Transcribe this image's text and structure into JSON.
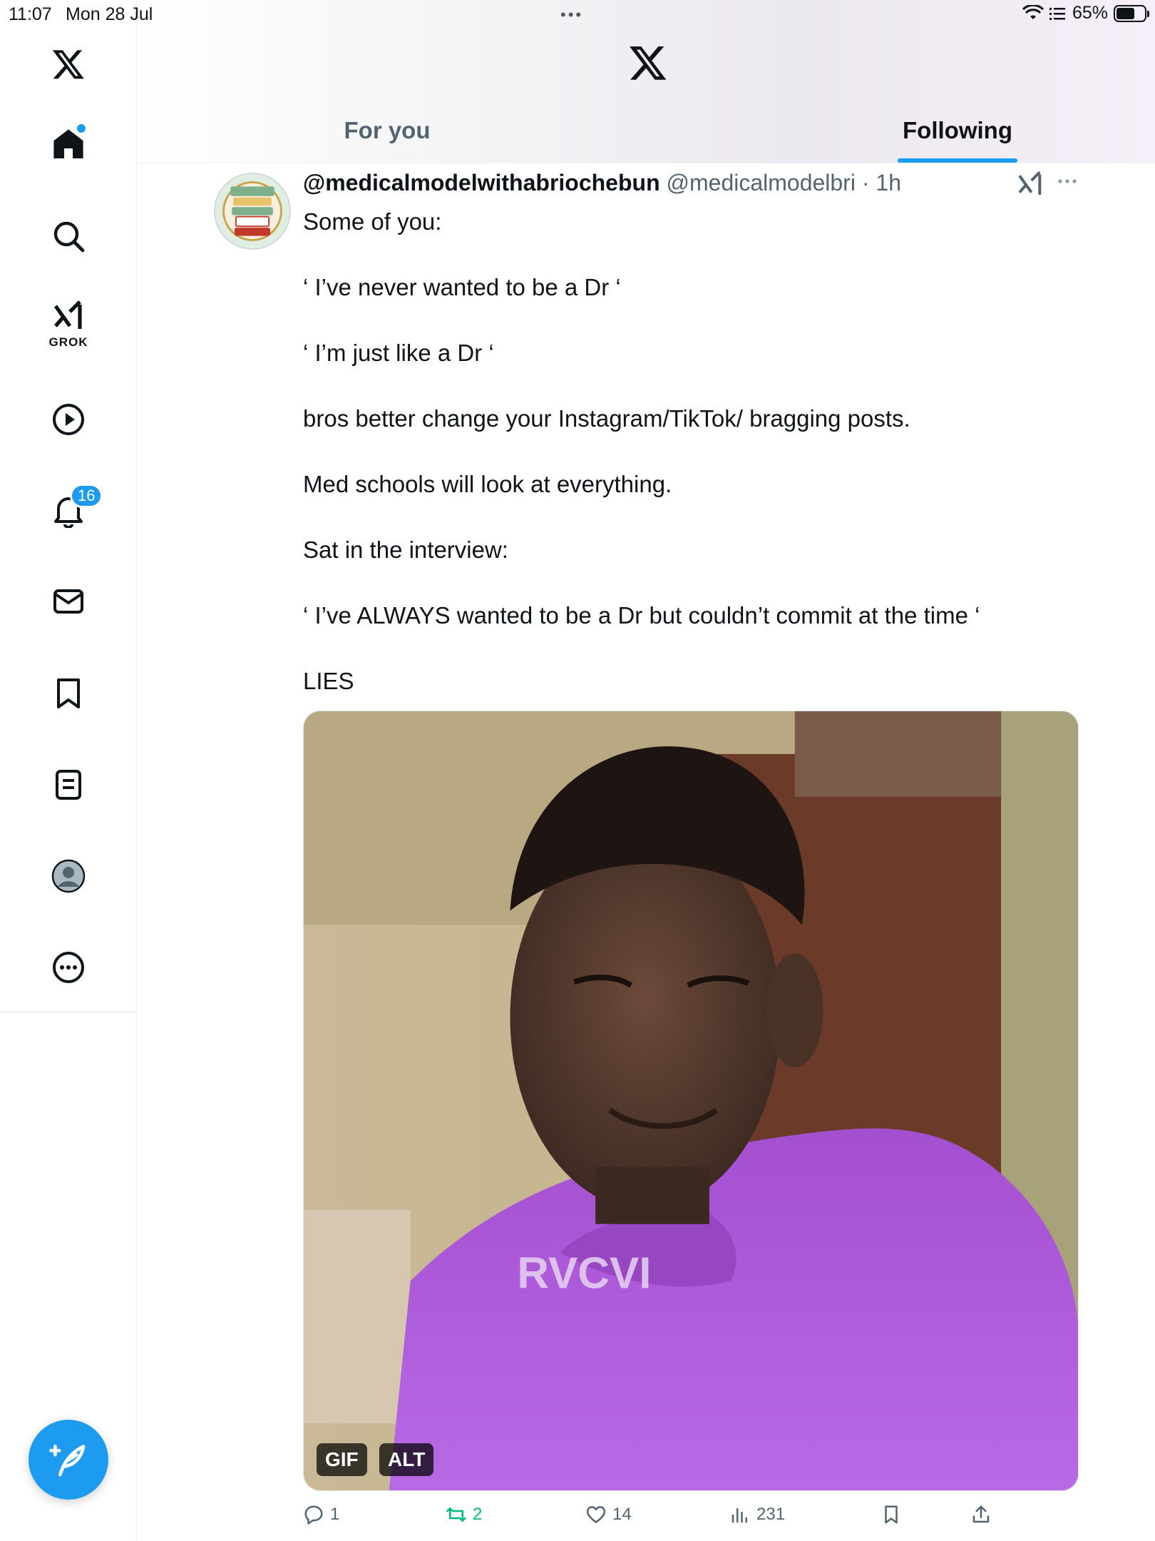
{
  "status_bar": {
    "time": "11:07",
    "date": "Mon 28 Jul",
    "battery": "65%",
    "battery_level": 0.65
  },
  "sidebar": {
    "items": [
      {
        "name": "x-logo",
        "icon": "x-logo-icon"
      },
      {
        "name": "home",
        "icon": "home-icon",
        "has_dot": true
      },
      {
        "name": "search",
        "icon": "search-icon"
      },
      {
        "name": "grok",
        "icon": "grok-icon",
        "label": "GROK"
      },
      {
        "name": "videos",
        "icon": "play-icon"
      },
      {
        "name": "notifications",
        "icon": "bell-icon",
        "badge": "16"
      },
      {
        "name": "messages",
        "icon": "mail-icon"
      },
      {
        "name": "bookmarks",
        "icon": "bookmark-icon"
      },
      {
        "name": "lists",
        "icon": "list-icon"
      },
      {
        "name": "profile",
        "icon": "avatar-icon"
      },
      {
        "name": "more",
        "icon": "more-icon"
      }
    ],
    "compose_icon": "compose-feather-icon"
  },
  "header": {
    "tabs": [
      {
        "label": "For you",
        "active": false
      },
      {
        "label": "Following",
        "active": true
      }
    ]
  },
  "tweet": {
    "display_name": "@medicalmodelwithabriochebun",
    "handle": "@medicalmodelbri",
    "time": "· 1h",
    "lines": [
      "Some of you:",
      "",
      " ‘ I’ve never wanted to be a Dr ‘",
      "",
      "‘ I’m just like a Dr ‘",
      "",
      "bros better change your Instagram/TikTok/ bragging posts.",
      "",
      "Med schools will look at everything.",
      "",
      "Sat in the interview:",
      "",
      " ‘ I’ve ALWAYS wanted to be a Dr but couldn’t commit at the time ‘",
      "",
      "LIES"
    ],
    "media": {
      "badge_gif": "GIF",
      "badge_alt": "ALT",
      "shirt_text": "RVCVI"
    },
    "actions": {
      "replies": "1",
      "retweets": "2",
      "likes": "14",
      "views": "231"
    }
  },
  "colors": {
    "accent": "#1d9bf0",
    "retweet_green": "#00ba7c",
    "text_secondary": "#536471"
  }
}
